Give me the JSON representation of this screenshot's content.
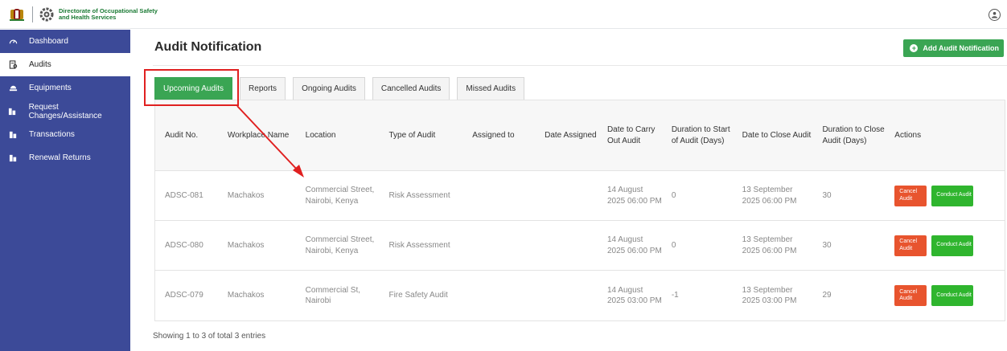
{
  "header": {
    "org_name_line1": "Directorate of Occupational Safety",
    "org_name_line2": "and Health Services"
  },
  "sidebar": {
    "items": [
      {
        "label": "Dashboard",
        "icon": "dashboard-icon"
      },
      {
        "label": "Audits",
        "icon": "audit-icon"
      },
      {
        "label": "Equipments",
        "icon": "equipment-icon"
      },
      {
        "label": "Request Changes/Assistance",
        "icon": "request-icon"
      },
      {
        "label": "Transactions",
        "icon": "transactions-icon"
      },
      {
        "label": "Renewal Returns",
        "icon": "renewal-icon"
      }
    ],
    "active_index": 1
  },
  "main": {
    "title": "Audit Notification",
    "add_button_label": "Add Audit Notification",
    "tabs": [
      "Upcoming Audits",
      "Reports",
      "Ongoing Audits",
      "Cancelled Audits",
      "Missed Audits"
    ],
    "active_tab": 0,
    "table": {
      "headers": [
        "Audit No.",
        "Workplace Name",
        "Location",
        "Type of Audit",
        "Assigned to",
        "Date Assigned",
        "Date to Carry Out Audit",
        "Duration to Start of Audit (Days)",
        "Date to Close Audit",
        "Duration to Close Audit (Days)",
        "Actions"
      ],
      "rows": [
        {
          "audit_no": "ADSC-081",
          "workplace": "Machakos",
          "location": "Commercial Street, Nairobi, Kenya",
          "type": "Risk Assessment",
          "assigned_to": "",
          "date_assigned": "",
          "date_carry_out": "14 August 2025 06:00 PM",
          "duration_start": "0",
          "date_close": "13 September 2025 06:00 PM",
          "duration_close": "30"
        },
        {
          "audit_no": "ADSC-080",
          "workplace": "Machakos",
          "location": "Commercial Street, Nairobi, Kenya",
          "type": "Risk Assessment",
          "assigned_to": "",
          "date_assigned": "",
          "date_carry_out": "14 August 2025 06:00 PM",
          "duration_start": "0",
          "date_close": "13 September 2025 06:00 PM",
          "duration_close": "30"
        },
        {
          "audit_no": "ADSC-079",
          "workplace": "Machakos",
          "location": "Commercial St, Nairobi",
          "type": "Fire Safety Audit",
          "assigned_to": "",
          "date_assigned": "",
          "date_carry_out": "14 August 2025 03:00 PM",
          "duration_start": "-1",
          "date_close": "13 September 2025 03:00 PM",
          "duration_close": "29"
        }
      ],
      "cancel_label": "Cancel Audit",
      "conduct_label": "Conduct Audit"
    },
    "footer": "Showing 1 to 3 of total 3 entries"
  },
  "colors": {
    "sidebar_bg": "#3c4a98",
    "accent_green": "#3aa553",
    "cancel_red": "#e8542e",
    "conduct_green": "#2fb52e",
    "annotation_red": "#e02020"
  }
}
